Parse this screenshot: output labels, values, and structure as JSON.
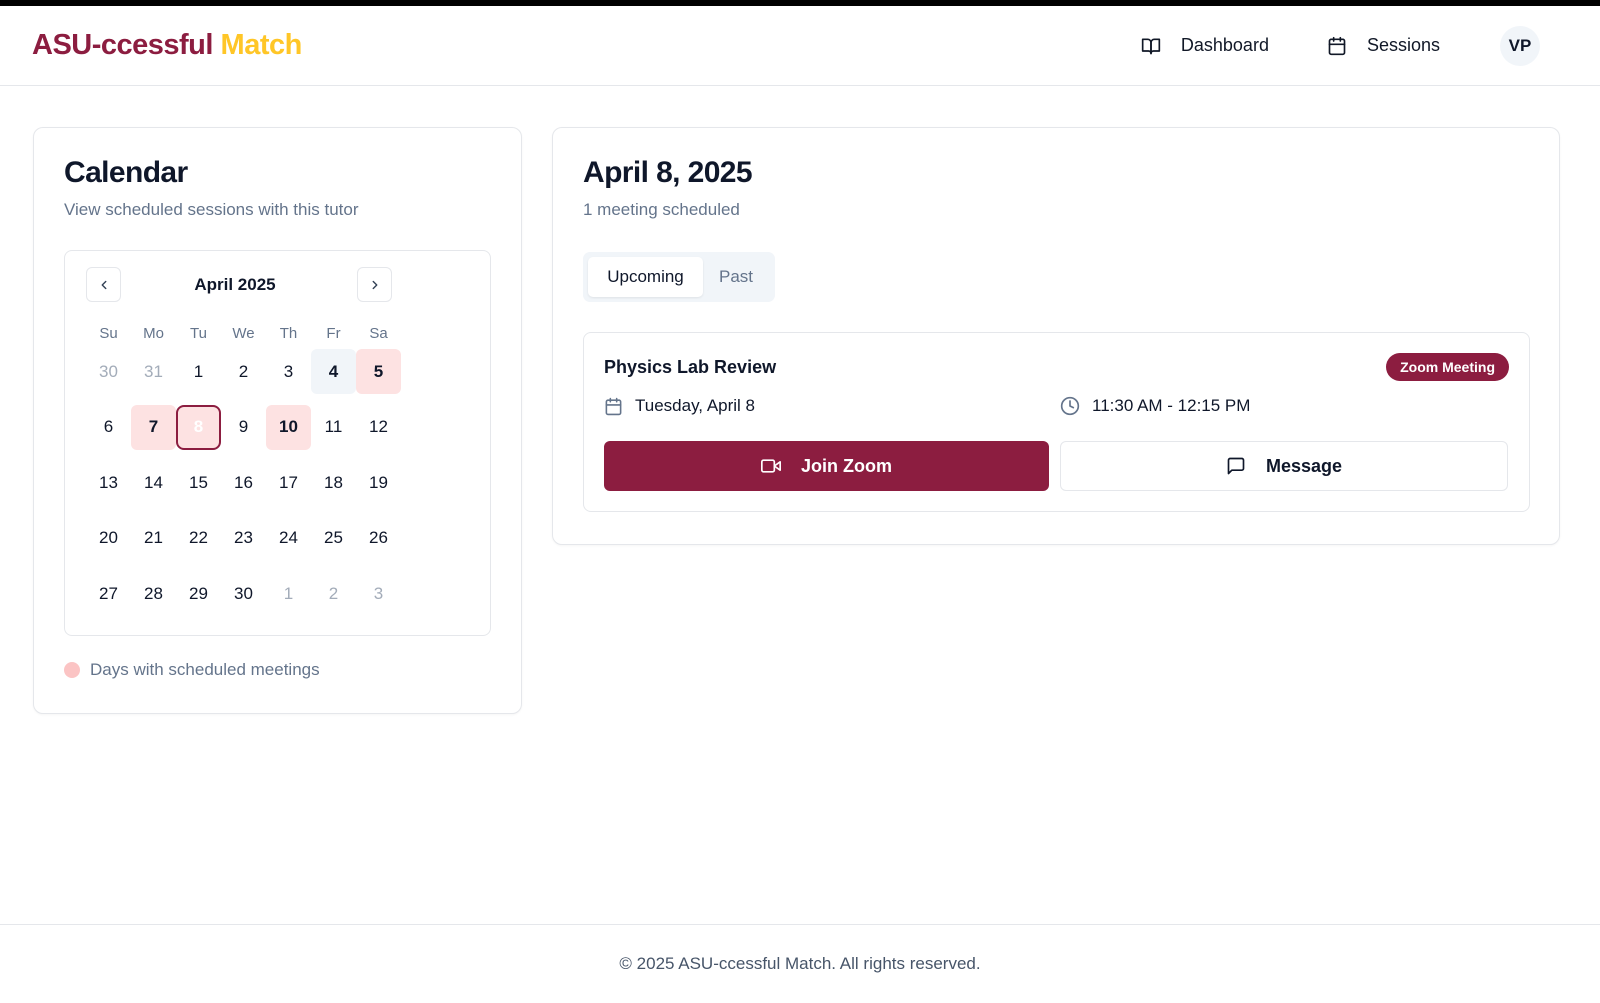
{
  "brand": {
    "part1": "ASU-ccessful",
    "part2": "Match",
    "maroon": "#8c1d40",
    "gold": "#ffc627"
  },
  "nav": {
    "dashboard": {
      "label": "Dashboard",
      "icon": "book-open-icon"
    },
    "sessions": {
      "label": "Sessions",
      "icon": "calendar-icon"
    },
    "avatar_initials": "VP"
  },
  "calendar": {
    "title": "Calendar",
    "subtitle": "View scheduled sessions with this tutor",
    "month_label": "April 2025",
    "weekdays": [
      "Su",
      "Mo",
      "Tu",
      "We",
      "Th",
      "Fr",
      "Sa"
    ],
    "days": [
      {
        "d": "30",
        "s": "muted"
      },
      {
        "d": "31",
        "s": "muted"
      },
      {
        "d": "1",
        "s": ""
      },
      {
        "d": "2",
        "s": ""
      },
      {
        "d": "3",
        "s": ""
      },
      {
        "d": "4",
        "s": "today"
      },
      {
        "d": "5",
        "s": "meeting"
      },
      {
        "d": "6",
        "s": ""
      },
      {
        "d": "7",
        "s": "meeting"
      },
      {
        "d": "8",
        "s": "selected"
      },
      {
        "d": "9",
        "s": ""
      },
      {
        "d": "10",
        "s": "meeting"
      },
      {
        "d": "11",
        "s": ""
      },
      {
        "d": "12",
        "s": ""
      },
      {
        "d": "13",
        "s": ""
      },
      {
        "d": "14",
        "s": ""
      },
      {
        "d": "15",
        "s": ""
      },
      {
        "d": "16",
        "s": ""
      },
      {
        "d": "17",
        "s": ""
      },
      {
        "d": "18",
        "s": ""
      },
      {
        "d": "19",
        "s": ""
      },
      {
        "d": "20",
        "s": ""
      },
      {
        "d": "21",
        "s": ""
      },
      {
        "d": "22",
        "s": ""
      },
      {
        "d": "23",
        "s": ""
      },
      {
        "d": "24",
        "s": ""
      },
      {
        "d": "25",
        "s": ""
      },
      {
        "d": "26",
        "s": ""
      },
      {
        "d": "27",
        "s": ""
      },
      {
        "d": "28",
        "s": ""
      },
      {
        "d": "29",
        "s": ""
      },
      {
        "d": "30",
        "s": ""
      },
      {
        "d": "1",
        "s": "muted"
      },
      {
        "d": "2",
        "s": "muted"
      },
      {
        "d": "3",
        "s": "muted"
      }
    ],
    "legend": "Days with scheduled meetings"
  },
  "day_view": {
    "title": "April 8, 2025",
    "subtitle": "1 meeting scheduled",
    "tabs": {
      "upcoming": "Upcoming",
      "past": "Past"
    },
    "meeting": {
      "title": "Physics Lab Review",
      "badge": "Zoom Meeting",
      "date": "Tuesday, April 8",
      "time": "11:30 AM - 12:15 PM",
      "join_label": "Join Zoom",
      "message_label": "Message"
    }
  },
  "footer": {
    "text": "© 2025 ASU-ccessful Match. All rights reserved."
  }
}
